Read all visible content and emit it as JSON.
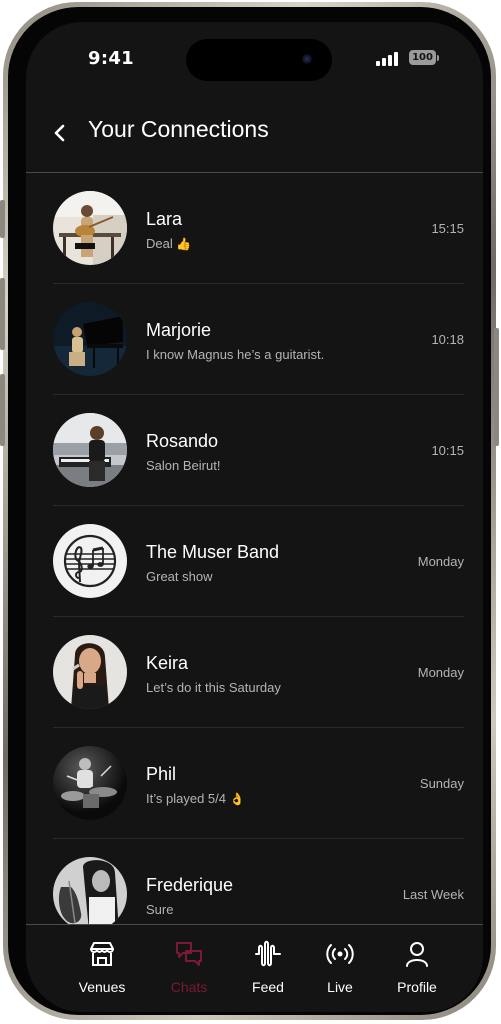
{
  "status_bar": {
    "time": "9:41",
    "battery": "100"
  },
  "header": {
    "title": "Your Connections"
  },
  "chats": [
    {
      "name": "Lara",
      "preview": "Deal",
      "emoji": "👍",
      "time": "15:15"
    },
    {
      "name": "Marjorie",
      "preview": "I know Magnus he’s a guitarist.",
      "emoji": "",
      "time": "10:18"
    },
    {
      "name": "Rosando",
      "preview": "Salon Beirut!",
      "emoji": "",
      "time": "10:15"
    },
    {
      "name": "The Muser Band",
      "preview": "Great show",
      "emoji": "",
      "time": "Monday"
    },
    {
      "name": "Keira",
      "preview": "Let’s do it this Saturday",
      "emoji": "",
      "time": "Monday"
    },
    {
      "name": "Phil",
      "preview": "It’s played 5/4",
      "emoji": "👌",
      "time": "Sunday"
    },
    {
      "name": "Frederique",
      "preview": "Sure",
      "emoji": "",
      "time": "Last Week"
    }
  ],
  "tab_bar": {
    "active_tab": "chats",
    "tabs": [
      {
        "id": "venues",
        "label": "Venues",
        "icon": "venues-icon"
      },
      {
        "id": "chats",
        "label": "Chats",
        "icon": "chats-icon"
      },
      {
        "id": "feed",
        "label": "Feed",
        "icon": "feed-icon"
      },
      {
        "id": "live",
        "label": "Live",
        "icon": "live-icon"
      },
      {
        "id": "profile",
        "label": "Profile",
        "icon": "profile-icon"
      }
    ]
  },
  "colors": {
    "background": "#141414",
    "accent": "#7a1a34",
    "text_primary": "#ffffff",
    "text_secondary": "#b4b4b4"
  }
}
